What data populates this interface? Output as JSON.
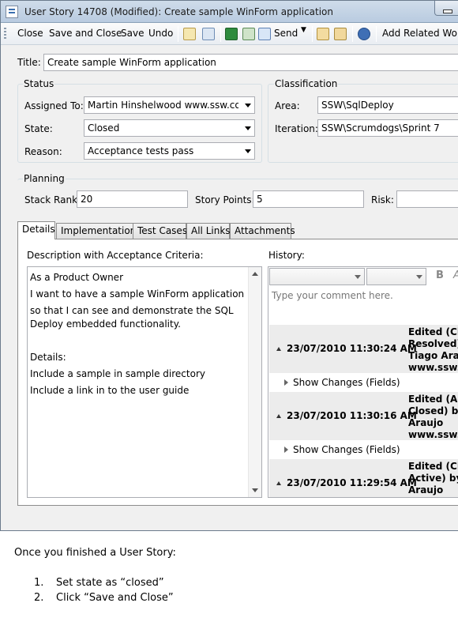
{
  "window": {
    "title": "User Story 14708 (Modified): Create sample WinForm application"
  },
  "toolbar": {
    "close": "Close",
    "save_and_close": "Save and Close",
    "save": "Save",
    "undo": "Undo",
    "send": "Send",
    "add_related": "Add Related Work"
  },
  "form": {
    "title_label": "Title:",
    "title_value": "Create sample WinForm application",
    "status": {
      "heading": "Status",
      "assigned_label": "Assigned To:",
      "assigned_value": "Martin Hinshelwood www.ssw.com.a",
      "state_label": "State:",
      "state_value": "Closed",
      "reason_label": "Reason:",
      "reason_value": "Acceptance tests pass"
    },
    "classification": {
      "heading": "Classification",
      "area_label": "Area:",
      "area_value": "SSW\\SqlDeploy",
      "iteration_label": "Iteration:",
      "iteration_value": "SSW\\Scrumdogs\\Sprint 7"
    },
    "planning": {
      "heading": "Planning",
      "stack_rank_label": "Stack Rank:",
      "stack_rank_value": "20",
      "story_points_label": "Story Points:",
      "story_points_value": "5",
      "risk_label": "Risk:",
      "risk_value": ""
    }
  },
  "tabs": [
    "Details",
    "Implementation",
    "Test Cases",
    "All Links",
    "Attachments"
  ],
  "details": {
    "desc_label": "Description with Acceptance Criteria:",
    "desc_lines": [
      "As a Product Owner",
      "I want to have a sample WinForm application",
      "so that I can see and demonstrate the SQL",
      "Deploy embedded functionality.",
      "",
      "Details:",
      "Include a sample in sample directory",
      "Include a link in to the user guide"
    ],
    "history_label": "History:",
    "comment_placeholder": "Type your comment here.",
    "bold_glyph": "B",
    "italic_glyph": "A",
    "entries": [
      {
        "date": "23/07/2010 11:30:24 AM",
        "info": "Edited (Clos\nResolved) b\nTiago Araujo\nwww.ssw.co"
      },
      {
        "date": "23/07/2010 11:30:16 AM",
        "info": "Edited (Activ\nClosed) by T\nAraujo\nwww.ssw.co"
      },
      {
        "date": "23/07/2010 11:29:54 AM",
        "info": "Edited (Clos\nActive) by T\nAraujo"
      }
    ],
    "show_changes": "Show Changes (Fields)"
  },
  "doc": {
    "caption": "Once you finished a User Story:",
    "steps": [
      {
        "n": "1.",
        "text": "Set state as “closed”"
      },
      {
        "n": "2.",
        "text": "Click “Save and Close”"
      }
    ]
  }
}
